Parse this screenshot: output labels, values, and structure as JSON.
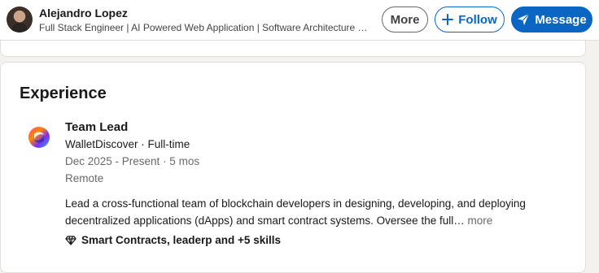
{
  "header": {
    "name": "Alejandro Lopez",
    "headline": "Full Stack Engineer | AI Powered Web Application | Software Architecture | Blockchain Developer",
    "more_label": "More",
    "follow_label": "Follow",
    "message_label": "Message",
    "accent_color": "#0a66c2"
  },
  "experience": {
    "title": "Experience",
    "items": [
      {
        "role": "Team Lead",
        "company": "WalletDiscover · Full-time",
        "dates": "Dec 2025 - Present · 5 mos",
        "location": "Remote",
        "description": "Lead a cross-functional team of blockchain developers in designing, developing, and deploying decentralized applications (dApps) and smart contract systems. Oversee the full…",
        "more_label": "more",
        "skills": "Smart Contracts, leaderp and +5 skills",
        "logo_icon": "walletdiscover-logo"
      }
    ]
  }
}
